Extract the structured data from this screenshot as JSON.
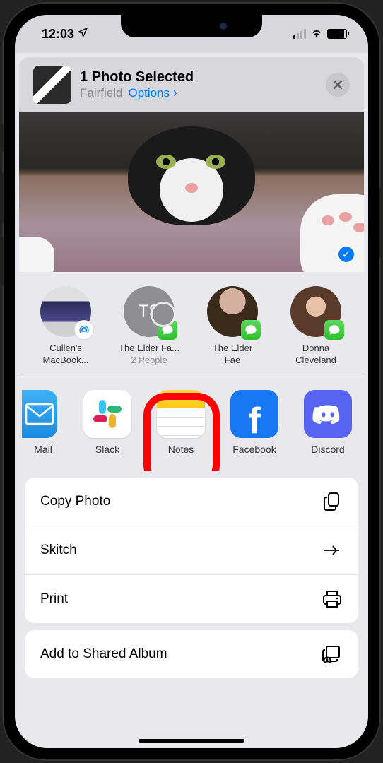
{
  "status": {
    "time": "12:03"
  },
  "header": {
    "title": "1 Photo Selected",
    "location": "Fairfield",
    "options_label": "Options"
  },
  "contacts": [
    {
      "name_l1": "Cullen's",
      "name_l2": "MacBook...",
      "type": "airdrop"
    },
    {
      "name_l1": "The Elder Fa...",
      "name_l2": "2 People",
      "initials": "TS",
      "type": "group-msg"
    },
    {
      "name_l1": "The Elder",
      "name_l2": "Fae",
      "type": "msg"
    },
    {
      "name_l1": "Donna",
      "name_l2": "Cleveland",
      "type": "msg"
    }
  ],
  "apps": [
    {
      "label": "Mail"
    },
    {
      "label": "Slack"
    },
    {
      "label": "Notes"
    },
    {
      "label": "Facebook"
    },
    {
      "label": "Discord"
    }
  ],
  "actions": [
    {
      "label": "Copy Photo",
      "icon": "copy"
    },
    {
      "label": "Skitch",
      "icon": "skitch"
    },
    {
      "label": "Print",
      "icon": "print"
    }
  ],
  "actions2": [
    {
      "label": "Add to Shared Album",
      "icon": "shared-album"
    }
  ],
  "highlighted_app_index": 2
}
